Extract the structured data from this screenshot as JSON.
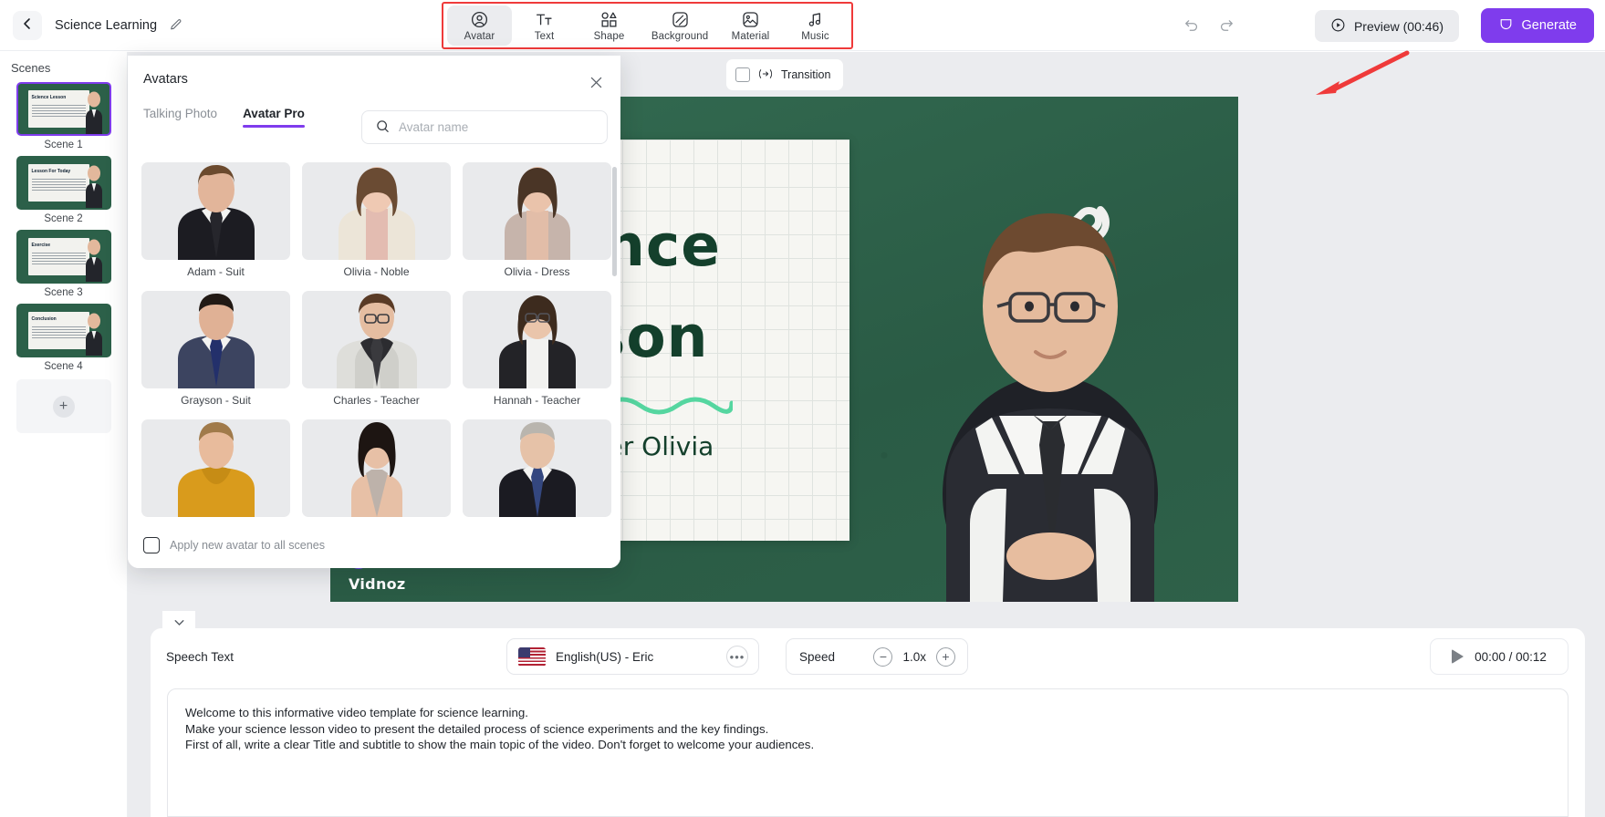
{
  "topbar": {
    "project_title": "Science Learning",
    "back_icon": "chevron-left-icon",
    "edit_icon": "pencil-icon",
    "tools": [
      {
        "label": "Avatar",
        "icon": "user-circle-icon",
        "active": true
      },
      {
        "label": "Text",
        "icon": "text-tt-icon",
        "active": false
      },
      {
        "label": "Shape",
        "icon": "shapes-grid-icon",
        "active": false
      },
      {
        "label": "Background",
        "icon": "background-icon",
        "active": false
      },
      {
        "label": "Material",
        "icon": "image-icon",
        "active": false
      },
      {
        "label": "Music",
        "icon": "music-note-icon",
        "active": false
      }
    ],
    "undo_icon": "undo-arrow-icon",
    "redo_icon": "redo-arrow-icon",
    "preview_label": "Preview (00:46)",
    "generate_label": "Generate",
    "accent_purple": "#7f3ced",
    "highlight_red": "#ef3a3a"
  },
  "scenes": {
    "heading": "Scenes",
    "items": [
      {
        "caption": "Scene 1",
        "board_title": "Science Lesson",
        "selected": true
      },
      {
        "caption": "Scene 2",
        "board_title": "Lesson For Today",
        "selected": false
      },
      {
        "caption": "Scene 3",
        "board_title": "Exercise",
        "selected": false
      },
      {
        "caption": "Scene 4",
        "board_title": "Conclusion",
        "selected": false
      }
    ],
    "add_scene_icon": "plus-icon"
  },
  "stage": {
    "transition_label": "Transition",
    "transition_icon": "transition-icon",
    "transition_checked": false,
    "canvas": {
      "title_line1": "Science",
      "title_line2": "Lesson",
      "subtitle": "with teacher Olivia",
      "watermark": "Vidnoz",
      "board_color": "#2d6049",
      "title_color": "#14402c",
      "squiggle_color": "#55d6a0"
    }
  },
  "avatars_panel": {
    "title": "Avatars",
    "close_icon": "close-icon",
    "tabs": [
      {
        "label": "Talking Photo",
        "active": false
      },
      {
        "label": "Avatar Pro",
        "active": true
      }
    ],
    "search": {
      "placeholder": "Avatar name",
      "value": "",
      "icon": "search-icon"
    },
    "grid": [
      [
        {
          "name": "Adam - Suit",
          "suit": "#1c1c22",
          "skin": "#e2b59a",
          "hair": "#6b4a2e"
        },
        {
          "name": "Olivia - Noble",
          "suit": "#ece5d8",
          "skin": "#efc9b3",
          "hair": "#6a4b33"
        },
        {
          "name": "Olivia - Dress",
          "suit": "#c6b4ab",
          "skin": "#eac3ab",
          "hair": "#4a3526"
        }
      ],
      [
        {
          "name": "Grayson - Suit",
          "suit": "#3c4460",
          "skin": "#e0b195",
          "hair": "#221a15"
        },
        {
          "name": "Charles - Teacher",
          "suit": "#2c2c30",
          "skin": "#e5bda1",
          "hair": "#5a3b26"
        },
        {
          "name": "Hannah - Teacher",
          "suit": "#232327",
          "skin": "#eac5ab",
          "hair": "#3d2b1e"
        }
      ],
      [
        {
          "name": "",
          "suit": "#d99b1c",
          "skin": "#e8bb9c",
          "hair": "#a07a4a"
        },
        {
          "name": "",
          "suit": "#bdb2aa",
          "skin": "#e7c0a6",
          "hair": "#1d1512"
        },
        {
          "name": "",
          "suit": "#1b1b22",
          "skin": "#e6c2a8",
          "hair": "#b9b5ae"
        }
      ]
    ],
    "footer": {
      "checkbox_label": "Apply new avatar to all scenes",
      "checked": false
    }
  },
  "bottom": {
    "collapse_icon": "chevron-down-icon",
    "speech_label": "Speech Text",
    "voice": {
      "name": "English(US) - Eric",
      "flag": "us-flag-icon",
      "more_icon": "more-dots-icon"
    },
    "speed": {
      "label": "Speed",
      "value": "1.0x",
      "minus_icon": "minus-icon",
      "plus_icon": "plus-icon"
    },
    "player": {
      "time": "00:00 / 00:12",
      "play_icon": "play-icon"
    },
    "script_lines": [
      "Welcome to this informative video template for science learning.",
      "Make your science lesson video to present the detailed process of science experiments and the key findings.",
      "First of all, write a clear Title and subtitle to show the main topic of the video. Don't forget to welcome your audiences."
    ]
  }
}
